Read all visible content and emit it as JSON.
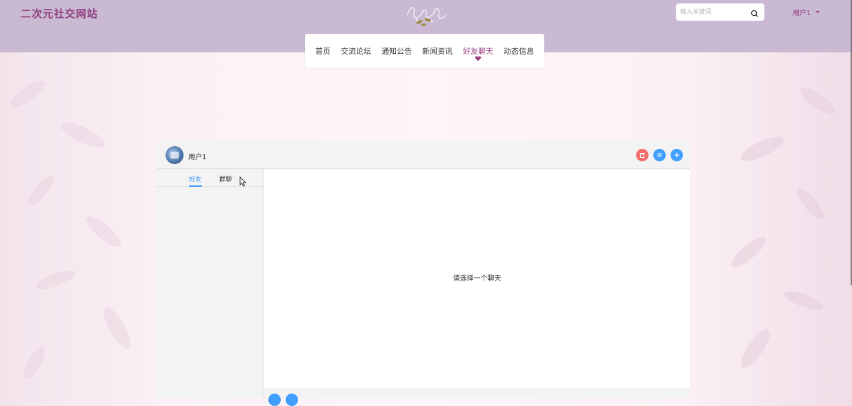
{
  "header": {
    "site_title": "二次元社交网站",
    "search_placeholder": "输入关键词",
    "user_label": "用户1"
  },
  "nav": {
    "items": [
      {
        "label": "首页"
      },
      {
        "label": "交流论坛"
      },
      {
        "label": "通知公告"
      },
      {
        "label": "新闻资讯"
      },
      {
        "label": "好友聊天"
      },
      {
        "label": "动态信息"
      }
    ],
    "active_index": 4
  },
  "chat": {
    "user_name": "用户1",
    "tabs": [
      {
        "label": "好友"
      },
      {
        "label": "群聊"
      }
    ],
    "active_tab": 0,
    "empty_text": "请选择一个聊天"
  },
  "colors": {
    "header_bg": "#c9b9d3",
    "brand": "#8f3f7e",
    "accent_blue": "#409eff",
    "accent_red": "#f56c6c"
  }
}
